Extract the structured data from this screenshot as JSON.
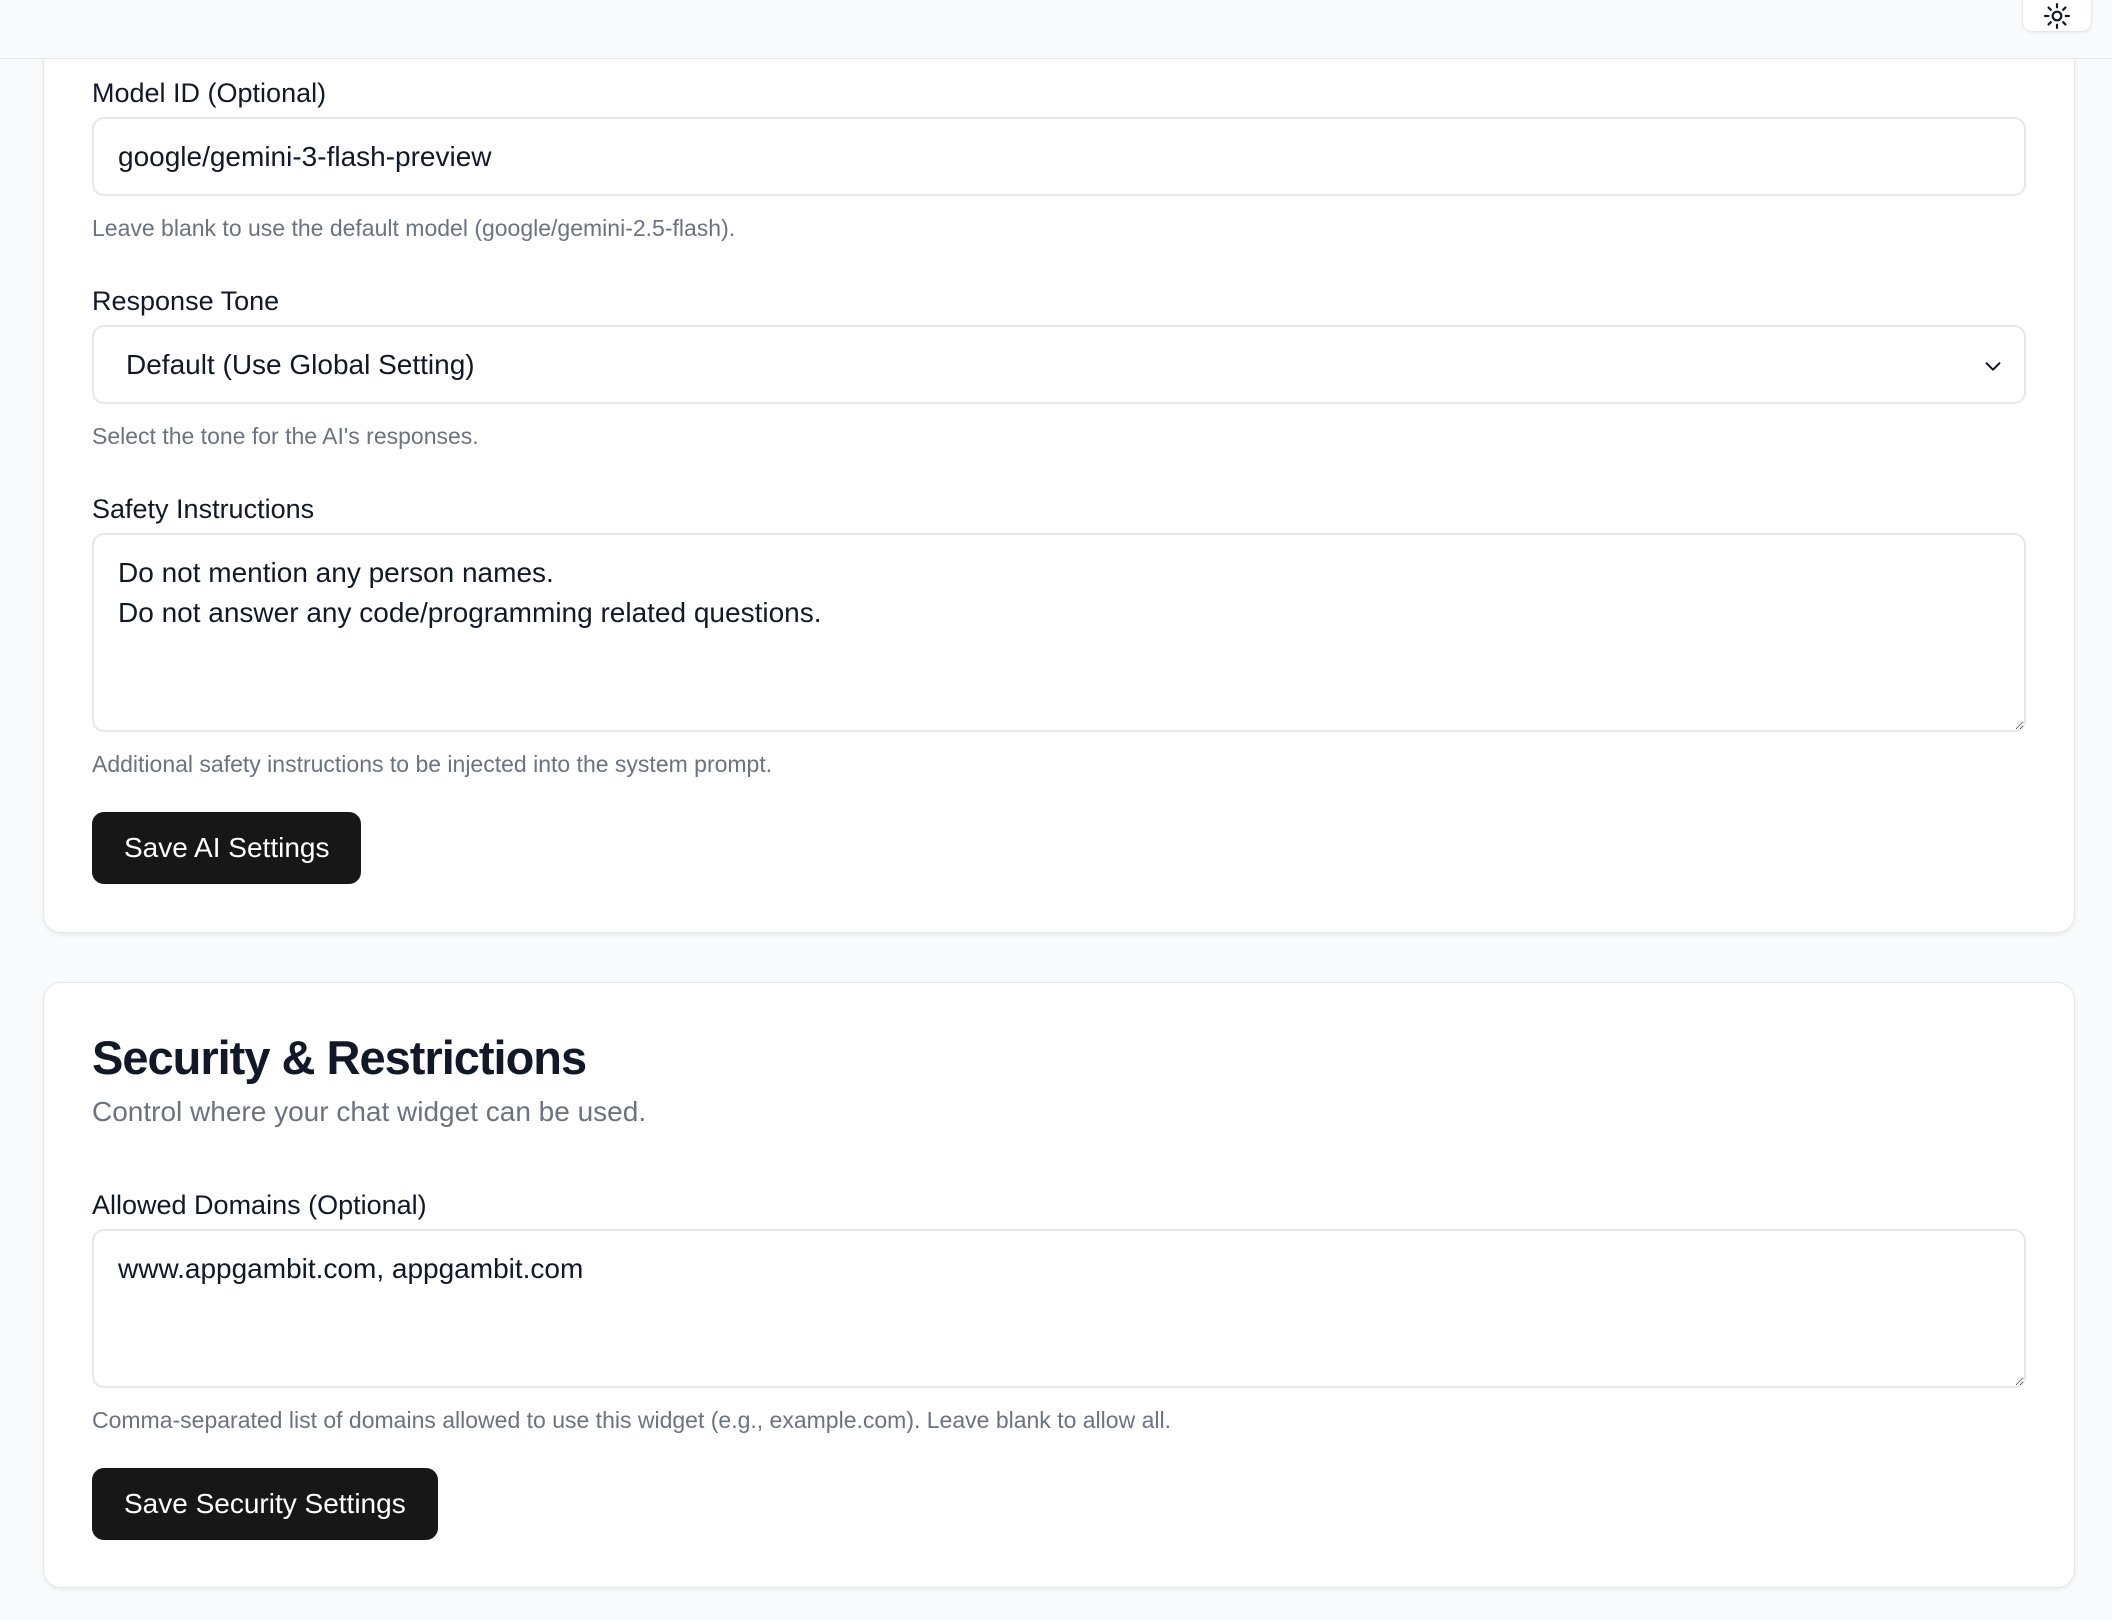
{
  "ai_settings": {
    "model_id": {
      "label": "Model ID (Optional)",
      "value": "google/gemini-3-flash-preview",
      "help": "Leave blank to use the default model (google/gemini-2.5-flash)."
    },
    "response_tone": {
      "label": "Response Tone",
      "selected": "Default (Use Global Setting)",
      "help": "Select the tone for the AI's responses."
    },
    "safety_instructions": {
      "label": "Safety Instructions",
      "value": "Do not mention any person names.\nDo not answer any code/programming related questions.",
      "help": "Additional safety instructions to be injected into the system prompt."
    },
    "save_label": "Save AI Settings"
  },
  "security": {
    "title": "Security & Restrictions",
    "subtitle": "Control where your chat widget can be used.",
    "allowed_domains": {
      "label": "Allowed Domains (Optional)",
      "value": "www.appgambit.com, appgambit.com",
      "help": "Comma-separated list of domains allowed to use this widget (e.g., example.com). Leave blank to allow all."
    },
    "save_label": "Save Security Settings"
  },
  "icons": {
    "theme_toggle": "sun-icon",
    "select_chevron": "chevron-down-icon"
  },
  "colors": {
    "button_bg": "#171717",
    "page_bg": "#f9fafb",
    "muted_text": "#6b7280"
  }
}
